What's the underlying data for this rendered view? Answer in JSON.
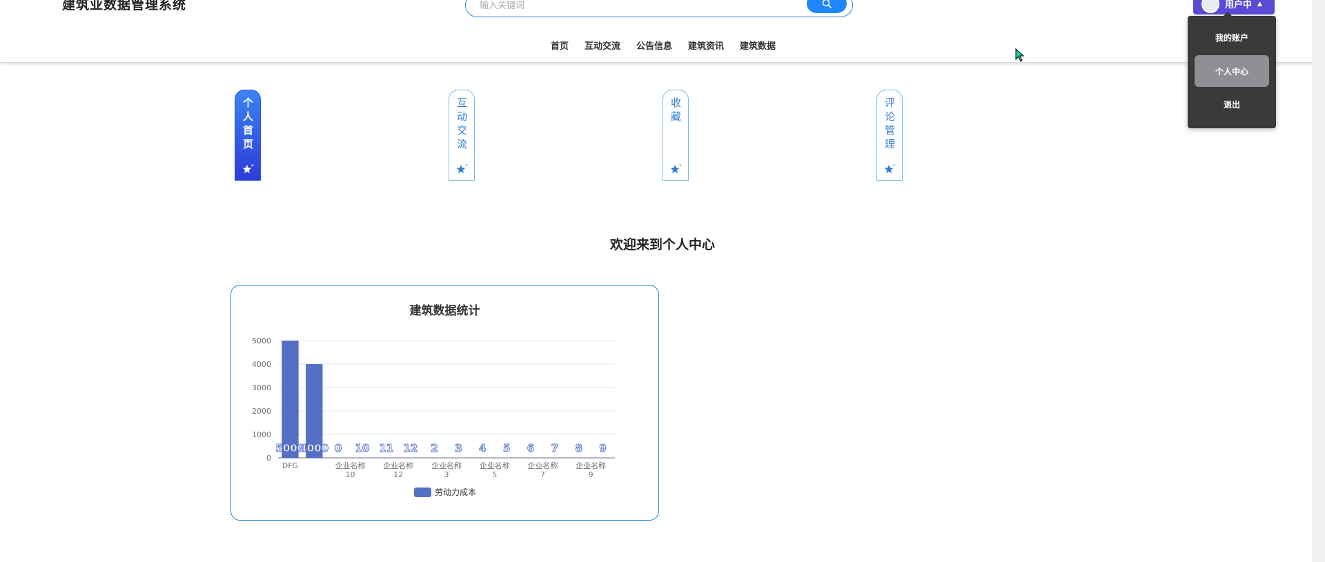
{
  "header": {
    "site_title": "建筑业数据管理系统",
    "search_placeholder": "输入关键词",
    "user_name": "用户中",
    "nav": [
      {
        "label": "首页"
      },
      {
        "label": "互动交流"
      },
      {
        "label": "公告信息"
      },
      {
        "label": "建筑资讯"
      },
      {
        "label": "建筑数据"
      }
    ]
  },
  "user_menu": {
    "items": [
      {
        "label": "我的账户",
        "active": false
      },
      {
        "label": "个人中心",
        "active": true
      },
      {
        "label": "退出",
        "active": false
      }
    ]
  },
  "tabs": [
    {
      "label": "个人首页",
      "active": true
    },
    {
      "label": "互动交流",
      "active": false
    },
    {
      "label": "收藏",
      "active": false
    },
    {
      "label": "评论管理",
      "active": false
    }
  ],
  "welcome_text": "欢迎来到个人中心",
  "colors": {
    "accent": "#2a7fd6",
    "bar": "#5470c6",
    "active_tab_top": "#3b84f0",
    "active_tab_bottom": "#2e3bd8"
  },
  "chart_data": {
    "type": "bar",
    "title": "建筑数据统计",
    "xlabel": "",
    "ylabel": "",
    "ylim": [
      0,
      5000
    ],
    "yticks": [
      0,
      1000,
      2000,
      3000,
      4000,
      5000
    ],
    "categories": [
      "DFG",
      "",
      "企业名称10",
      "",
      "企业名称12",
      "",
      "企业名称3",
      "",
      "企业名称5",
      "",
      "企业名称7",
      "",
      "企业名称9"
    ],
    "x_tick_labels": [
      {
        "index": 0,
        "lines": [
          "DFG"
        ]
      },
      {
        "index": 2,
        "lines": [
          "企业名称",
          "10"
        ]
      },
      {
        "index": 4,
        "lines": [
          "企业名称",
          "12"
        ]
      },
      {
        "index": 6,
        "lines": [
          "企业名称",
          "3"
        ]
      },
      {
        "index": 8,
        "lines": [
          "企业名称",
          "5"
        ]
      },
      {
        "index": 10,
        "lines": [
          "企业名称",
          "7"
        ]
      },
      {
        "index": 12,
        "lines": [
          "企业名称",
          "9"
        ]
      }
    ],
    "series": [
      {
        "name": "劳动力成本",
        "values": [
          5000,
          4000,
          0,
          10,
          11,
          12,
          2,
          3,
          4,
          5,
          6,
          7,
          8,
          9
        ]
      }
    ],
    "data_labels": [
      "5000",
      "4000",
      "0",
      "10",
      "11",
      "12",
      "2",
      "3",
      "4",
      "5",
      "6",
      "7",
      "8",
      "9"
    ],
    "legend": "bottom-center",
    "grid": true
  }
}
